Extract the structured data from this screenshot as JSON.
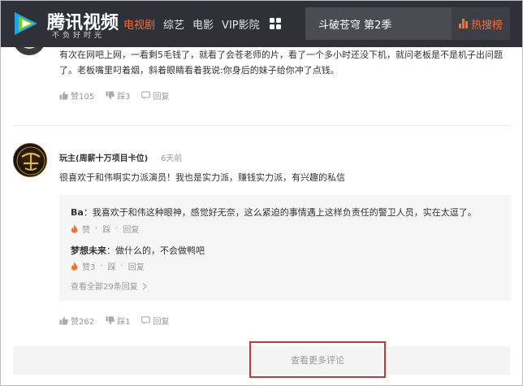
{
  "brand": {
    "title": "腾讯视频",
    "slogan": "不负好时光",
    "colors": {
      "accent": "#ff6c2c",
      "header_bg": "#2f3038",
      "highlight_border": "#c0393b"
    }
  },
  "nav": {
    "items": [
      "电视剧",
      "综艺",
      "电影",
      "VIP影院"
    ],
    "active": "电视剧"
  },
  "search": {
    "query": "斗破苍穹 第2季",
    "hot_label": "热搜榜"
  },
  "comment1": {
    "text": "有次在网吧上网，一看剩5毛钱了，就看了会苍老师的片，看了一个多小时还没下机，就问老板是不是机子出问题了。老板嘴里叼着烟，斜着眼睛看着我说:你身后的妹子给你冲了点钱。",
    "likes": "赞105",
    "dislikes": "踩3",
    "reply": "回复"
  },
  "comment2": {
    "user": "玩主(周薪十万项目卡位)",
    "time": "6天前",
    "text": "很喜欢于和伟啊实力派演员！我也是实力派，赚钱实力派，有兴趣的私信",
    "likes": "赞262",
    "dislikes": "踩1",
    "reply": "回复",
    "replies": [
      {
        "user": "Ba",
        "text": "：我喜欢于和伟这种眼神，感觉好无奈，这么紧迫的事情遇上这样负责任的警卫人员，实在太逗了。",
        "likes": "赞",
        "dislikes": "踩",
        "reply": "回复"
      },
      {
        "user": "梦想未来",
        "text": "：做什么的，不会做鸭吧",
        "likes": "赞3",
        "dislikes": "踩",
        "reply": "回复"
      }
    ],
    "more_replies": "查看全部29条回复"
  },
  "load_more": "查看更多评论",
  "icons": [
    "video-play-logo-icon",
    "grid-menu-icon",
    "hot-chart-icon",
    "thumb-up-icon",
    "thumb-down-icon",
    "reply-icon",
    "flame-icon",
    "chevron-right-icon"
  ]
}
